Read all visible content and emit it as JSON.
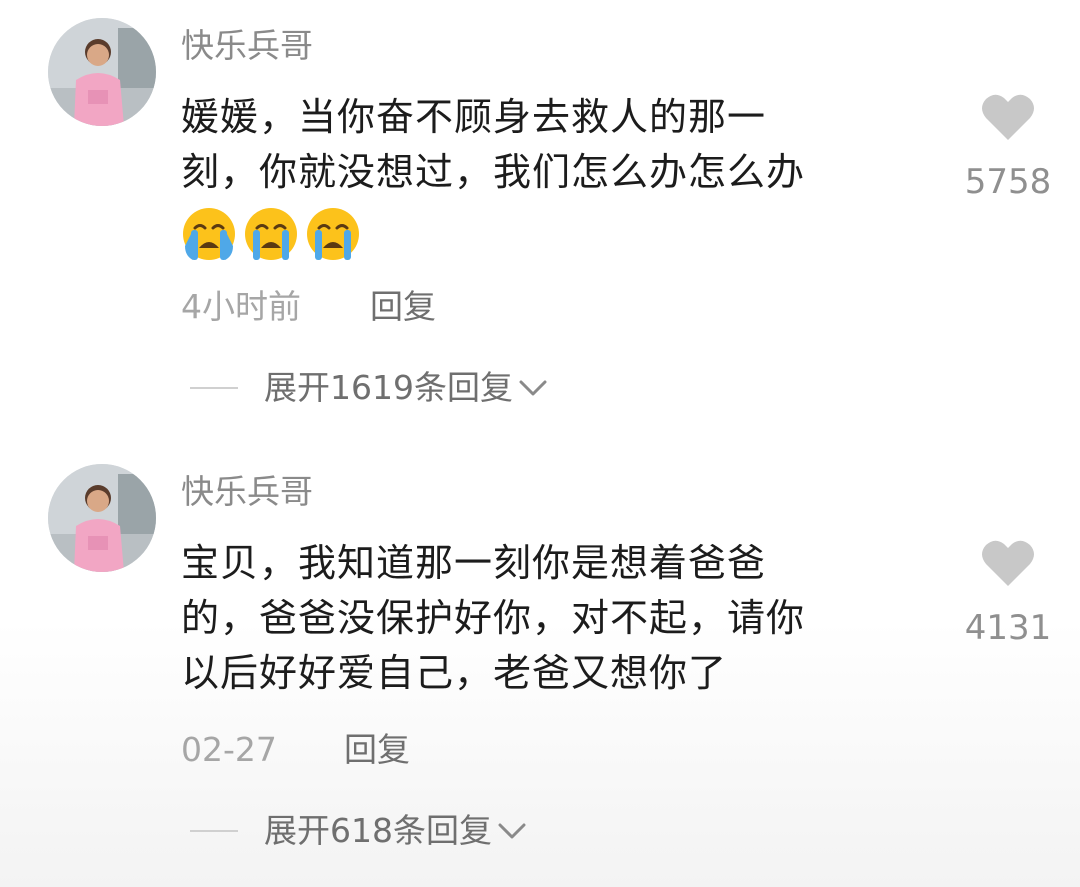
{
  "comments": [
    {
      "username": "快乐兵哥",
      "lines": [
        "媛媛，当你奋不顾身去救人的那一",
        "刻，你就没想过，我们怎么办怎么办"
      ],
      "emojis": [
        "crying-emoji",
        "crying-emoji",
        "crying-emoji"
      ],
      "time": "4小时前",
      "reply_label": "回复",
      "likes": "5758",
      "expand_label": "展开1619条回复"
    },
    {
      "username": "快乐兵哥",
      "lines": [
        "宝贝，我知道那一刻你是想着爸爸",
        "的，爸爸没保护好你，对不起，请你",
        "以后好好爱自己，老爸又想你了"
      ],
      "emojis": [],
      "time": "02-27",
      "reply_label": "回复",
      "likes": "4131",
      "expand_label": "展开618条回复"
    }
  ],
  "icons": {
    "heart": "heart-icon",
    "expand": "chevron-down-icon"
  },
  "colors": {
    "heart": "#c8c8c8",
    "username": "#8a8a8a",
    "body_text": "#1c1c1c",
    "meta": "#a6a6a6",
    "emoji_face": "#fcc21b",
    "emoji_tears": "#4fa8e8"
  }
}
